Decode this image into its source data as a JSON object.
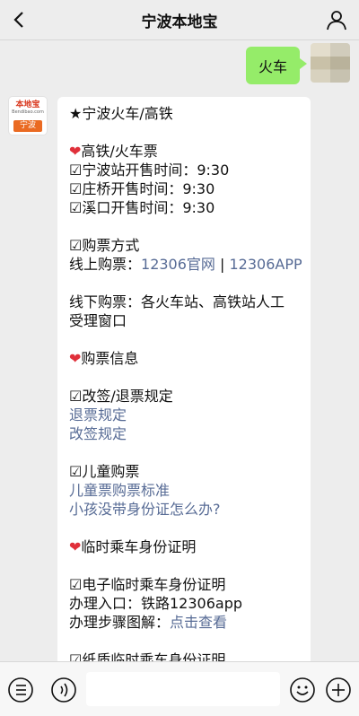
{
  "header": {
    "title": "宁波本地宝"
  },
  "outgoing": {
    "text": "火车"
  },
  "incoming": {
    "avatar": {
      "logo_text": "本地宝",
      "logo_sub": "Bendibao.com",
      "city": "宁波"
    },
    "lines": [
      {
        "text": "★宁波火车/高铁",
        "kind": "text"
      },
      {
        "text": "",
        "kind": "blank"
      },
      {
        "text": "❤️高铁/火车票",
        "kind": "text"
      },
      {
        "text": "☑宁波站开售时间：9:30",
        "kind": "text"
      },
      {
        "text": "☑庄桥开售时间：9:30",
        "kind": "text"
      },
      {
        "text": "☑溪口开售时间：9:30",
        "kind": "text"
      },
      {
        "text": "",
        "kind": "blank"
      },
      {
        "text": "☑购票方式",
        "kind": "text"
      },
      {
        "prefix": "线上购票：",
        "link1": "12306官网",
        "sep": " | ",
        "link2": "12306APP",
        "kind": "links"
      },
      {
        "text": "",
        "kind": "blank"
      },
      {
        "text": "线下购票：各火车站、高铁站人工",
        "kind": "text"
      },
      {
        "text": "受理窗口",
        "kind": "text"
      },
      {
        "text": "",
        "kind": "blank"
      },
      {
        "text": "❤️购票信息",
        "kind": "text"
      },
      {
        "text": "",
        "kind": "blank"
      },
      {
        "text": "☑改签/退票规定",
        "kind": "text"
      },
      {
        "text": "退票规定",
        "kind": "link"
      },
      {
        "text": "改签规定",
        "kind": "link"
      },
      {
        "text": "",
        "kind": "blank"
      },
      {
        "text": "☑儿童购票",
        "kind": "text"
      },
      {
        "text": "儿童票购票标准",
        "kind": "link"
      },
      {
        "text": "小孩没带身份证怎么办?",
        "kind": "link"
      },
      {
        "text": "",
        "kind": "blank"
      },
      {
        "text": "❤️临时乘车身份证明",
        "kind": "text"
      },
      {
        "text": "",
        "kind": "blank"
      },
      {
        "text": "☑电子临时乘车身份证明",
        "kind": "text"
      },
      {
        "text": "办理入口：铁路12306app",
        "kind": "text"
      },
      {
        "prefix": "办理步骤图解：",
        "link1": "点击查看",
        "kind": "links"
      },
      {
        "text": "",
        "kind": "blank"
      },
      {
        "text": "☑纸质临时乘车身份证明",
        "kind": "text"
      }
    ]
  },
  "icons": {
    "back": "chevron-left-icon",
    "profile": "user-icon",
    "menu": "list-icon",
    "voice": "voice-icon",
    "emoji": "emoji-icon",
    "add": "plus-icon"
  },
  "colors": {
    "background": "#ededed",
    "outgoing_bubble": "#95ec69",
    "link": "#576b95",
    "heart": "#e0303a",
    "brand_orange": "#ea6a22"
  }
}
